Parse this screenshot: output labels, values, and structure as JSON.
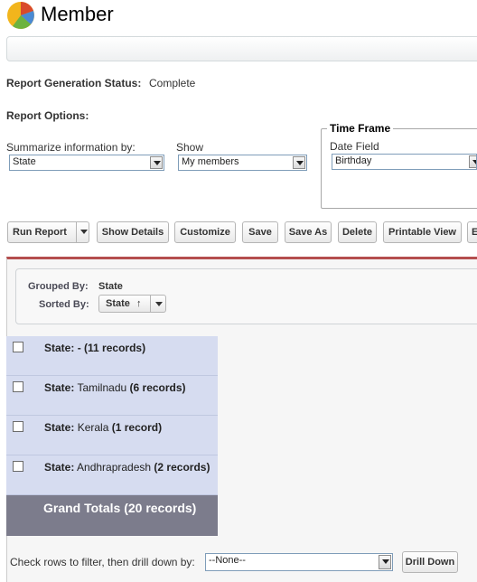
{
  "header": {
    "title": "Member"
  },
  "status": {
    "label": "Report Generation Status:",
    "value": "Complete"
  },
  "options": {
    "heading": "Report Options:",
    "summarize": {
      "label": "Summarize information by:",
      "value": "State"
    },
    "show": {
      "label": "Show",
      "value": "My members"
    },
    "timeframe": {
      "legend": "Time Frame",
      "date_field_label": "Date Field",
      "date_field_value": "Birthday"
    }
  },
  "toolbar": {
    "run_report": "Run Report",
    "show_details": "Show Details",
    "customize": "Customize",
    "save": "Save",
    "save_as": "Save As",
    "delete": "Delete",
    "printable_view": "Printable View",
    "export_partial": "E"
  },
  "report": {
    "grouped_by_label": "Grouped By:",
    "grouped_by_value": "State",
    "sorted_by_label": "Sorted By:",
    "sorted_by_value": "State",
    "sort_arrow": "↑",
    "groups": [
      {
        "prefix": "State:",
        "name": "-",
        "count": "(11 records)"
      },
      {
        "prefix": "State:",
        "name": "Tamilnadu",
        "count": "(6 records)"
      },
      {
        "prefix": "State:",
        "name": "Kerala",
        "count": "(1 record)"
      },
      {
        "prefix": "State:",
        "name": "Andhrapradesh",
        "count": "(2 records)"
      }
    ],
    "grand_totals": "Grand Totals (20 records)"
  },
  "drilldown": {
    "label": "Check rows to filter, then drill down by:",
    "value": "--None--",
    "button": "Drill Down"
  },
  "colors": {
    "accent_bar": "#b44e4e",
    "group_row": "#d6dcf0",
    "totals_row": "#7c7c8c"
  }
}
